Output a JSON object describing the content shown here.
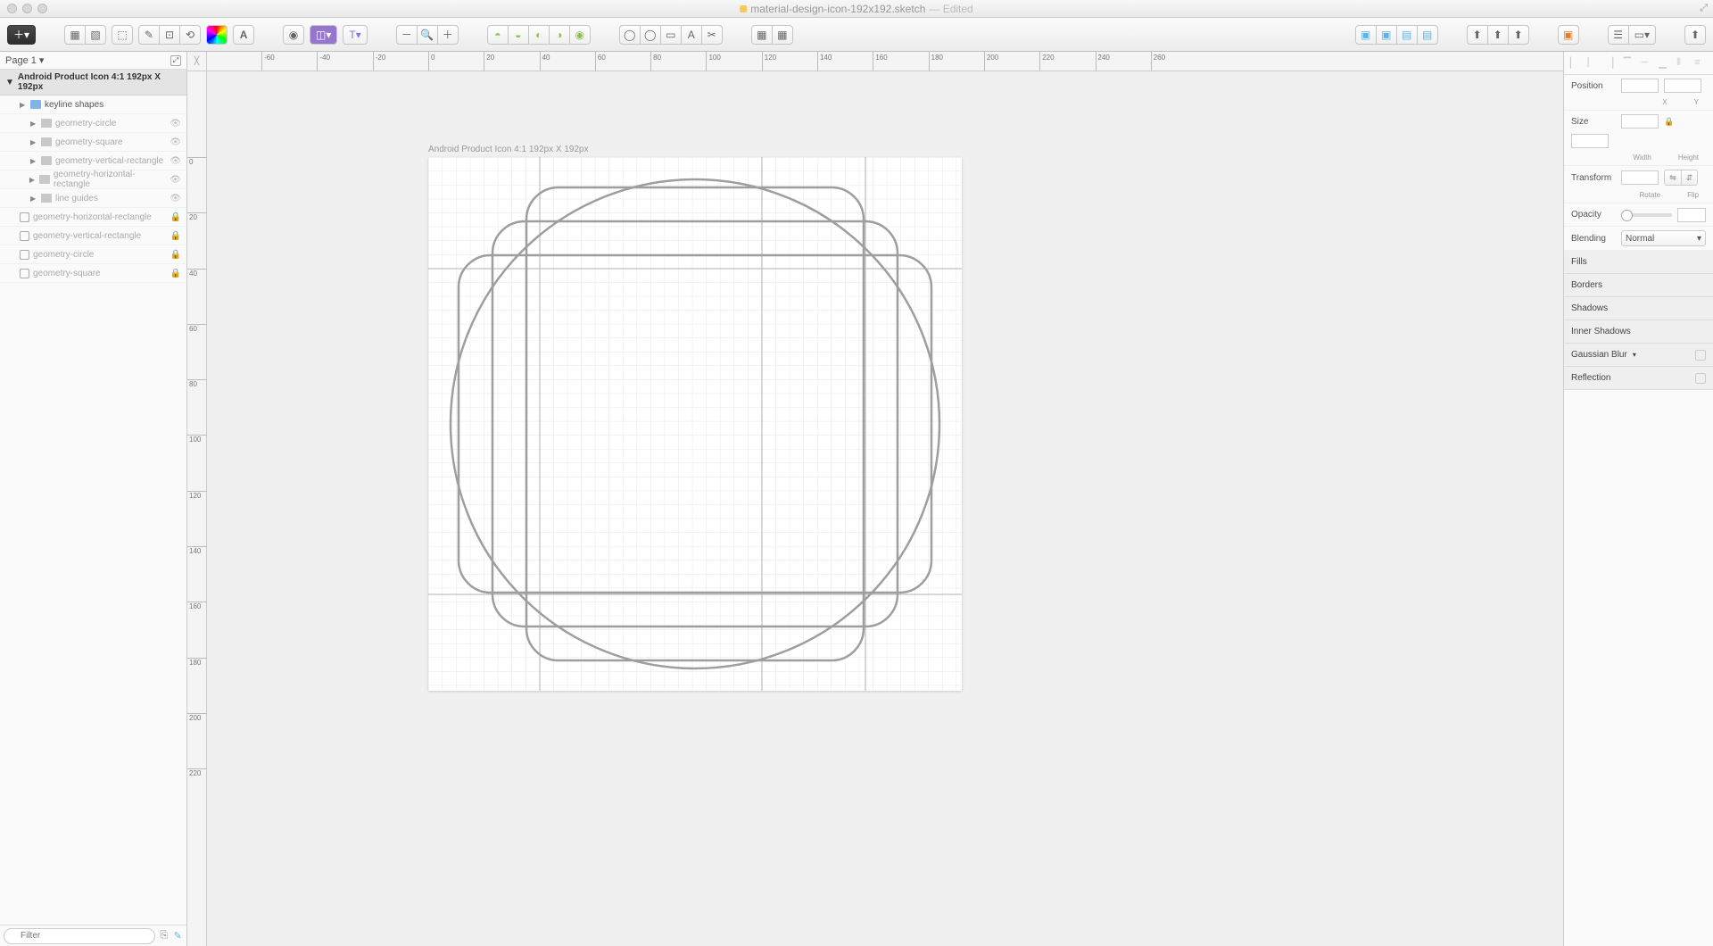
{
  "title": {
    "filename": "material-design-icon-192x192.sketch",
    "status": "— Edited"
  },
  "page": {
    "label": "Page 1"
  },
  "artboard": {
    "name": "Android Product Icon 4:1 192px X 192px"
  },
  "layers": [
    {
      "name": "keyline shapes",
      "type": "folder",
      "indent": 1,
      "dim": false,
      "vis": ""
    },
    {
      "name": "geometry-circle",
      "type": "folder",
      "indent": 2,
      "dim": true,
      "vis": "eye"
    },
    {
      "name": "geometry-square",
      "type": "folder",
      "indent": 2,
      "dim": true,
      "vis": "eye"
    },
    {
      "name": "geometry-vertical-rectangle",
      "type": "folder",
      "indent": 2,
      "dim": true,
      "vis": "eye"
    },
    {
      "name": "geometry-horizontal-rectangle",
      "type": "folder",
      "indent": 2,
      "dim": true,
      "vis": "eye"
    },
    {
      "name": "line guides",
      "type": "folder",
      "indent": 2,
      "dim": true,
      "vis": "eye"
    },
    {
      "name": "geometry-horizontal-rectangle",
      "type": "shape",
      "indent": 1,
      "dim": true,
      "vis": "lock"
    },
    {
      "name": "geometry-vertical-rectangle",
      "type": "shape",
      "indent": 1,
      "dim": true,
      "vis": "lock"
    },
    {
      "name": "geometry-circle",
      "type": "shape",
      "indent": 1,
      "dim": true,
      "vis": "lock"
    },
    {
      "name": "geometry-square",
      "type": "shape",
      "indent": 1,
      "dim": true,
      "vis": "lock"
    }
  ],
  "filter": {
    "placeholder": "Filter"
  },
  "ruler_h": [
    "-60",
    "-40",
    "-20",
    "0",
    "20",
    "40",
    "60",
    "80",
    "100",
    "120",
    "140",
    "160",
    "180",
    "200",
    "220",
    "240",
    "260"
  ],
  "ruler_v": [
    "0",
    "20",
    "40",
    "60",
    "80",
    "100",
    "120",
    "140",
    "160",
    "180",
    "200",
    "220"
  ],
  "inspector": {
    "position": {
      "label": "Position",
      "x_label": "X",
      "y_label": "Y"
    },
    "size": {
      "label": "Size",
      "w_label": "Width",
      "h_label": "Height",
      "lock": "🔒"
    },
    "transform": {
      "label": "Transform",
      "rotate_label": "Rotate",
      "flip_label": "Flip"
    },
    "opacity": {
      "label": "Opacity"
    },
    "blending": {
      "label": "Blending",
      "value": "Normal"
    },
    "sections": [
      "Fills",
      "Borders",
      "Shadows",
      "Inner Shadows"
    ],
    "gaussian": "Gaussian Blur",
    "reflection": "Reflection"
  }
}
